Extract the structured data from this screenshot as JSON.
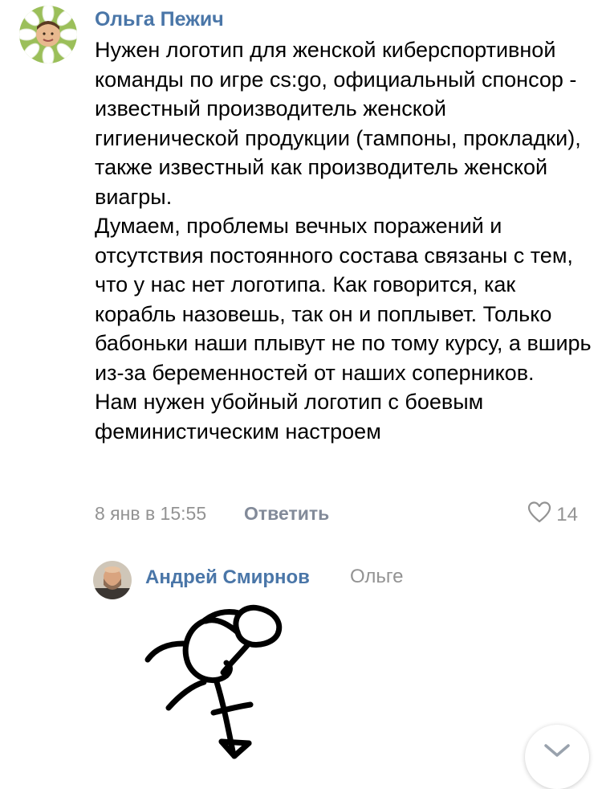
{
  "comment": {
    "author": "Ольга Пежич",
    "text": [
      "Нужен логотип для женской киберспортивной команды по игре cs:go, официальный спонсор - известный производитель женской гигиенической продукции (тампоны, прокладки), также известный как производитель женской виагры.",
      "Думаем, проблемы вечных поражений и отсутствия постоянного состава связаны с тем, что у нас нет логотипа. Как говорится, как корабль назовешь, так он и поплывет. Только бабоньки наши плывут не по тому курсу, а вширь из-за беременностей от наших соперников.",
      "Нам нужен убойный логотип с боевым феминистическим настроем"
    ],
    "timestamp": "8 янв в 15:55",
    "reply_label": "Ответить",
    "likes": "14"
  },
  "reply": {
    "author": "Андрей Смирнов",
    "addressee": "Ольге"
  },
  "icons": {
    "like": "heart-outline-icon",
    "scroll": "chevron-down-icon"
  },
  "colors": {
    "author": "#4a76a8",
    "meta": "#939393",
    "reply_link": "#828a99"
  }
}
